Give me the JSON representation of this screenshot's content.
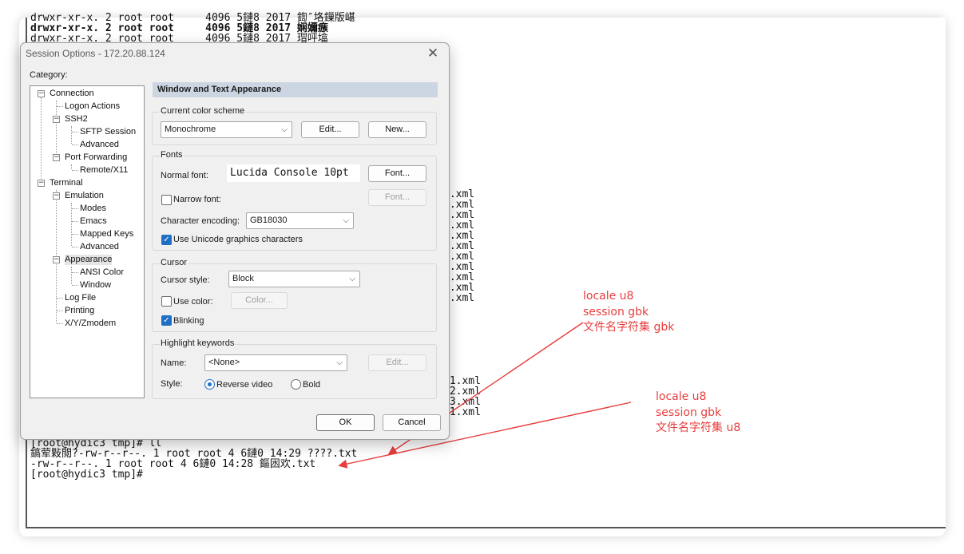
{
  "terminal": {
    "top_lines": [
      "drwxr-xr-x. 2 root root     4096 5鏈8 2017 鍧″垎鏁版嵁",
      "drwxr-xr-x. 2 root root     4096 5鏈8 2017 娴嬭瘯",
      "drwxr-xr-x. 2 root root     4096 5鏈8 2017 瑁呯墖"
    ],
    "right_fragments_1": [
      "1.xml",
      "1.xml",
      "0.xml",
      "0.xml",
      "0.xml",
      "0.xml",
      "0.xml",
      "1.xml",
      "1.xml",
      "0.xml",
      "5.xml"
    ],
    "right_fragments_2": [
      "01.xml",
      "02.xml",
      "03.xml",
      "01.xml"
    ],
    "bottom_lines": [
      "[root@hydic3 tmp]# ll",
      "鎬荤敤閲?-rw-r--r--. 1 root root 4 6鏈0 14:29 ????.txt",
      "-rw-r--r--. 1 root root 4 6鏈0 14:28 鏂囦欢.txt",
      "[root@hydic3 tmp]#"
    ]
  },
  "annotations": [
    [
      "locale u8",
      "session gbk",
      "文件名字符集 gbk"
    ],
    [
      "locale u8",
      "session gbk",
      "文件名字符集 u8"
    ]
  ],
  "dialog": {
    "title": "Session Options - 172.20.88.124",
    "close_glyph": "✕",
    "category_label": "Category:",
    "tree": {
      "connection": "Connection",
      "logon_actions": "Logon Actions",
      "ssh2": "SSH2",
      "sftp_session": "SFTP Session",
      "ssh2_advanced": "Advanced",
      "port_forwarding": "Port Forwarding",
      "remote_x11": "Remote/X11",
      "terminal": "Terminal",
      "emulation": "Emulation",
      "modes": "Modes",
      "emacs": "Emacs",
      "mapped_keys": "Mapped Keys",
      "emulation_advanced": "Advanced",
      "appearance": "Appearance",
      "ansi_color": "ANSI Color",
      "window": "Window",
      "log_file": "Log File",
      "printing": "Printing",
      "xyzmodem": "X/Y/Zmodem"
    },
    "section_title": "Window and Text Appearance",
    "color_scheme": {
      "group_title": "Current color scheme",
      "value": "Monochrome",
      "edit_label": "Edit...",
      "new_label": "New..."
    },
    "fonts": {
      "group_title": "Fonts",
      "normal_font_label": "Normal font:",
      "normal_font_value": "Lucida Console 10pt",
      "font_button": "Font...",
      "narrow_font_label": "Narrow font:",
      "narrow_font_button": "Font...",
      "encoding_label": "Character encoding:",
      "encoding_value": "GB18030",
      "unicode_label": "Use Unicode graphics characters"
    },
    "cursor": {
      "group_title": "Cursor",
      "style_label": "Cursor style:",
      "style_value": "Block",
      "use_color_label": "Use color:",
      "color_button": "Color...",
      "blinking_label": "Blinking"
    },
    "highlight": {
      "group_title": "Highlight keywords",
      "name_label": "Name:",
      "name_value": "<None>",
      "edit_button": "Edit...",
      "style_label": "Style:",
      "reverse_label": "Reverse video",
      "bold_label": "Bold"
    },
    "ok_label": "OK",
    "cancel_label": "Cancel",
    "check_glyph": "✓",
    "dropdown_glyph": "⌵",
    "tree_minus": "−"
  },
  "colors": {
    "annotation": "#e83d3d",
    "accent": "#1f6fc5",
    "section_header": "#ccd6e3"
  }
}
